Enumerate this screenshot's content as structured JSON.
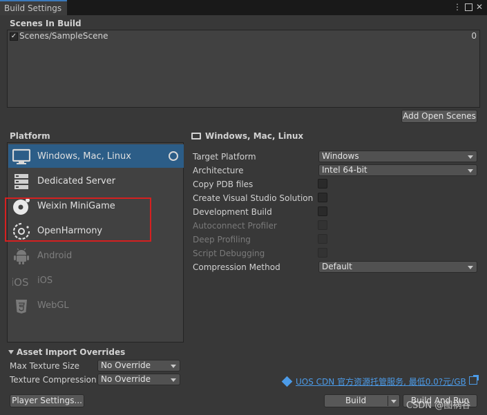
{
  "window": {
    "tab_title": "Build Settings"
  },
  "scenes": {
    "title": "Scenes In Build",
    "items": [
      {
        "name": "Scenes/SampleScene",
        "index": "0",
        "checked": true
      }
    ],
    "add_open_scenes_label": "Add Open Scenes"
  },
  "platform": {
    "title": "Platform",
    "items": [
      {
        "label": "Windows, Mac, Linux",
        "icon": "monitor-icon",
        "selected": true,
        "enabled": true
      },
      {
        "label": "Dedicated Server",
        "icon": "server-icon",
        "enabled": true
      },
      {
        "label": "Weixin MiniGame",
        "icon": "weixin-minigame-icon",
        "enabled": true
      },
      {
        "label": "OpenHarmony",
        "icon": "openharmony-icon",
        "enabled": true
      },
      {
        "label": "Android",
        "icon": "android-icon",
        "enabled": false
      },
      {
        "label": "iOS",
        "icon": "ios-icon",
        "icon_text": "iOS",
        "enabled": false
      },
      {
        "label": "WebGL",
        "icon": "html5-icon",
        "icon_text": "HTML 5",
        "enabled": false
      }
    ]
  },
  "settings": {
    "header": "Windows, Mac, Linux",
    "target_platform": {
      "label": "Target Platform",
      "value": "Windows"
    },
    "architecture": {
      "label": "Architecture",
      "value": "Intel 64-bit"
    },
    "copy_pdb": {
      "label": "Copy PDB files"
    },
    "create_vs": {
      "label": "Create Visual Studio Solution"
    },
    "development_build": {
      "label": "Development Build"
    },
    "autoconnect_profiler": {
      "label": "Autoconnect Profiler"
    },
    "deep_profiling": {
      "label": "Deep Profiling"
    },
    "script_debugging": {
      "label": "Script Debugging"
    },
    "compression": {
      "label": "Compression Method",
      "value": "Default"
    }
  },
  "asset_import": {
    "title": "Asset Import Overrides",
    "max_texture_size": {
      "label": "Max Texture Size",
      "value": "No Override"
    },
    "texture_compression": {
      "label": "Texture Compression",
      "value": "No Override"
    }
  },
  "footer": {
    "cdn_link": "UOS CDN 官方资源托管服务, 最低0.0?元/GB",
    "player_settings": "Player Settings...",
    "build": "Build",
    "build_and_run": "Build And Run",
    "watermark": "CSDN @图祸谷"
  },
  "colors": {
    "selection": "#2c5d87",
    "accent_tab": "#3a79bb",
    "link": "#4c9be8",
    "highlight_box": "#d62020"
  }
}
